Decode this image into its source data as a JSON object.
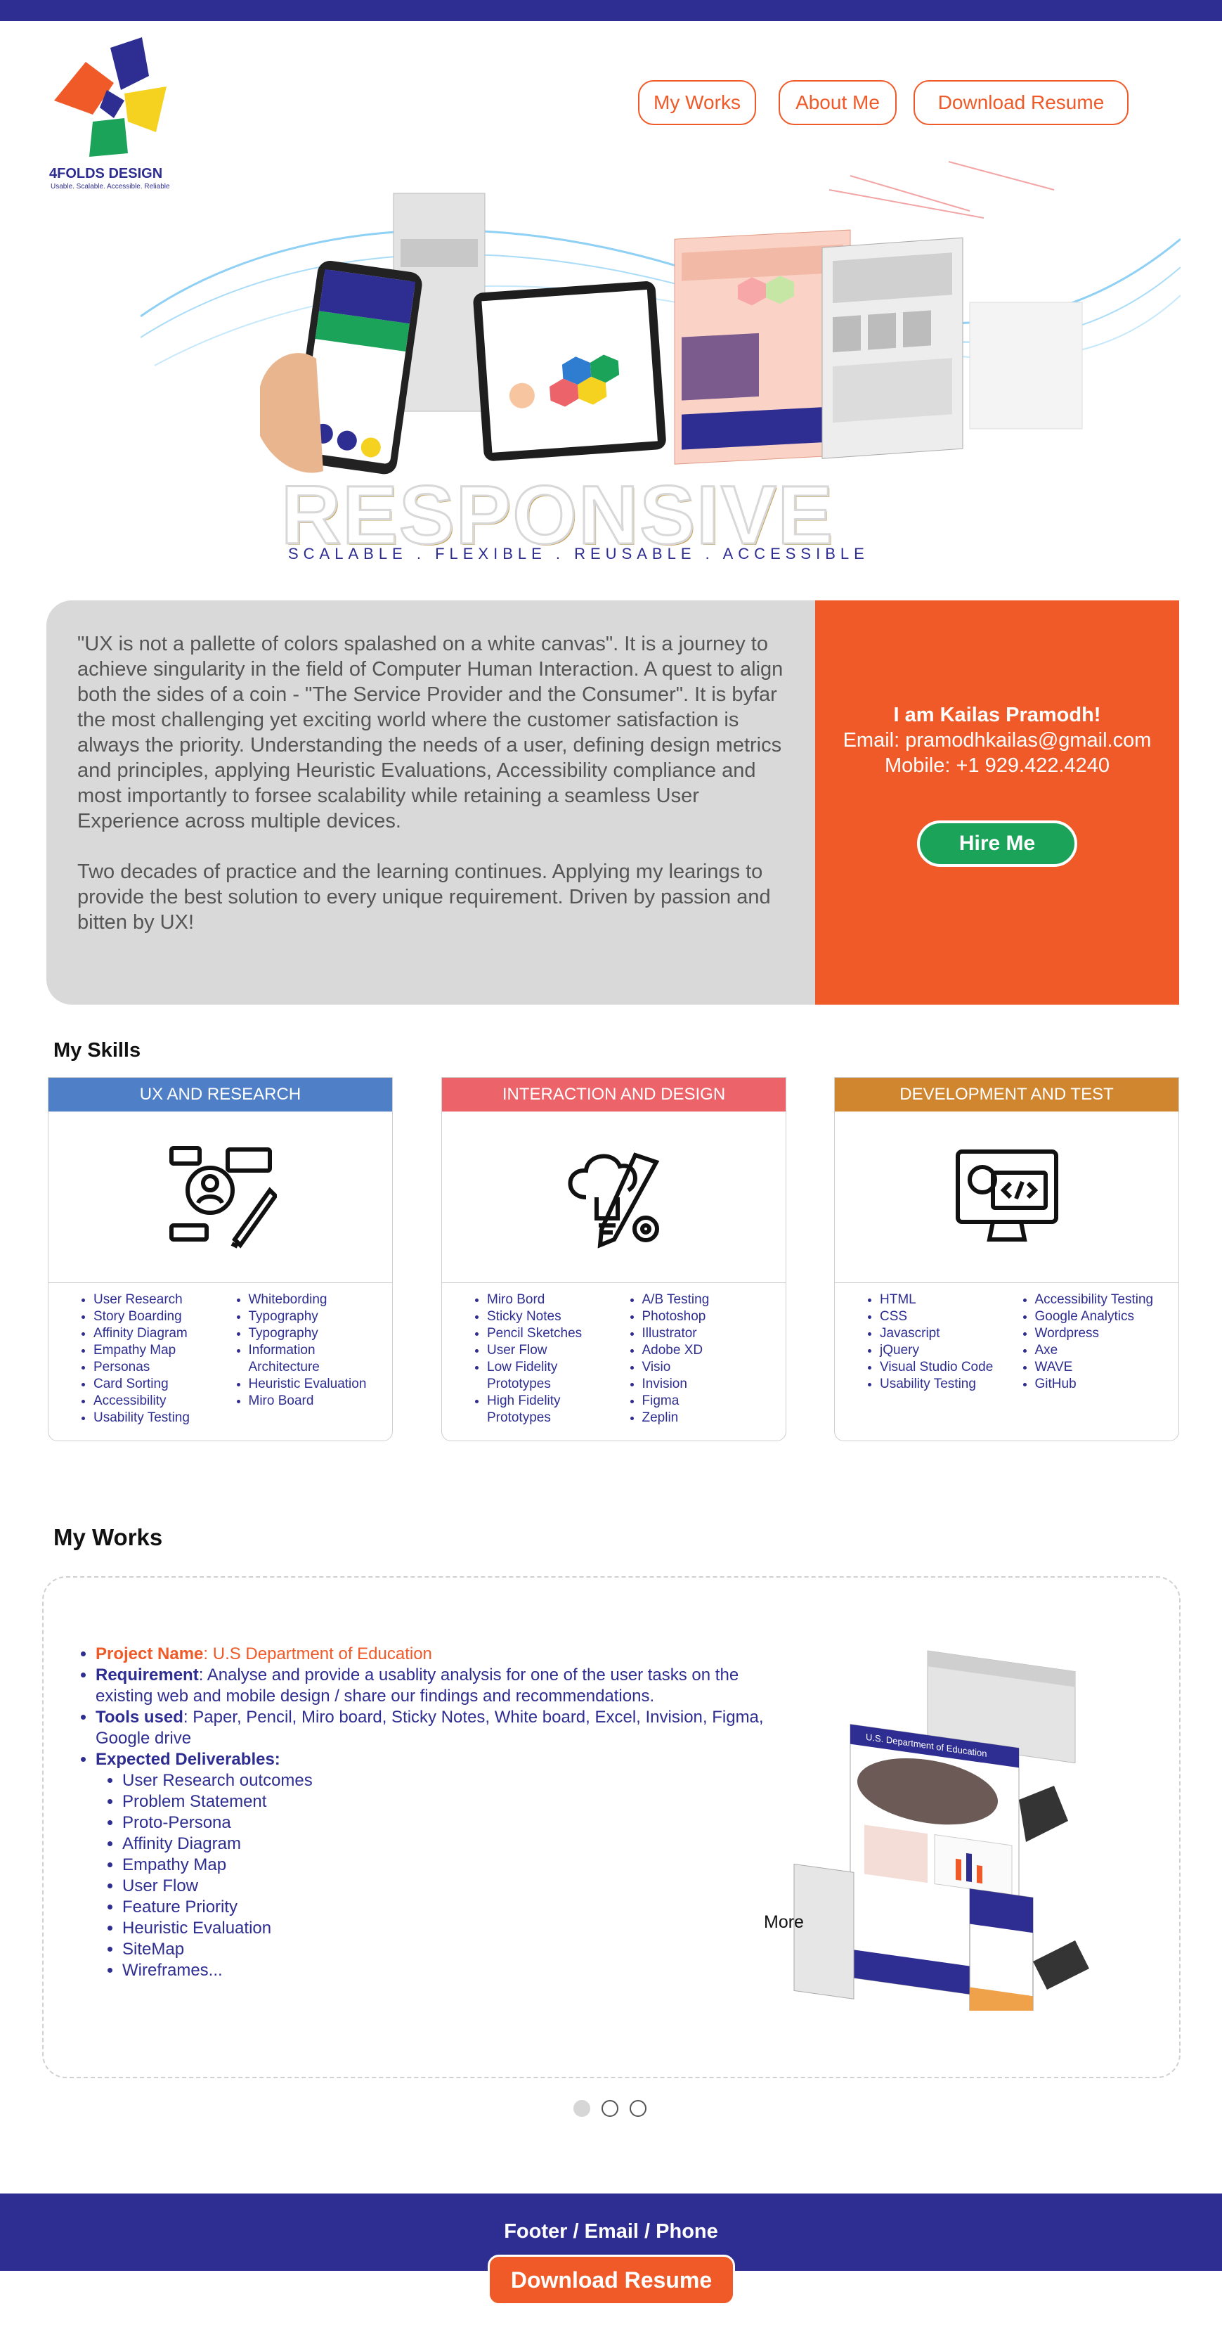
{
  "brand": {
    "name": "4FOLDS DESIGN",
    "tagline": "Usable. Scalable. Accessible. Reliable"
  },
  "nav": {
    "works": "My Works",
    "about": "About Me",
    "resume": "Download Resume"
  },
  "hero": {
    "word": "RESPONSIVE",
    "subtitle": "SCALABLE . FLEXIBLE . REUSABLE . ACCESSIBLE"
  },
  "intro": {
    "p1": "\"UX is not a pallette of colors spalashed on a white canvas\". It is a journey to achieve singularity in the field of Computer Human Interaction. A quest to align both the sides of a coin - \"The Service Provider and the Consumer\". It is byfar the most challenging yet exciting world where the customer satisfaction is always the priority. Understanding the needs of a user, defining design metrics and principles, applying Heuristic Evaluations, Accessibility compliance and most importantly to forsee scalability while retaining a seamless User Experience across multiple devices.",
    "p2": "Two decades of practice and the learning continues. Applying my learings to provide the best solution to every unique requirement. Driven by passion and bitten by UX!"
  },
  "contact": {
    "name": "I am Kailas Pramodh!",
    "email": "Email: pramodhkailas@gmail.com",
    "phone": "Mobile: +1 929.422.4240",
    "hire": "Hire Me"
  },
  "skills": {
    "title": "My Skills",
    "cards": [
      {
        "header": "UX AND RESEARCH",
        "color": "#4f7fc6",
        "left": [
          "User Research",
          "Story Boarding",
          "Affinity Diagram",
          "Empathy Map",
          "Personas",
          "Card Sorting",
          "Accessibility",
          "Usability Testing"
        ],
        "right": [
          "Whitebording",
          "Typography",
          "Typography",
          "Information Architecture",
          "Heuristic Evaluation",
          "Miro Board"
        ]
      },
      {
        "header": "INTERACTION AND DESIGN",
        "color": "#ec6469",
        "left": [
          "Miro Bord",
          "Sticky Notes",
          "Pencil Sketches",
          "User Flow",
          "Low Fidelity Prototypes",
          "High Fidelity Prototypes"
        ],
        "right": [
          "A/B Testing",
          "Photoshop",
          "Illustrator",
          "Adobe XD",
          "Visio",
          "Invision",
          "Figma",
          "Zeplin"
        ]
      },
      {
        "header": "DEVELOPMENT AND TEST",
        "color": "#d0852f",
        "left": [
          "HTML",
          "CSS",
          "Javascript",
          "jQuery",
          "Visual Studio Code",
          "Usability Testing"
        ],
        "right": [
          "Accessibility Testing",
          "Google Analytics",
          "Wordpress",
          "Axe",
          "WAVE",
          "GitHub"
        ]
      }
    ]
  },
  "works": {
    "title": "My Works",
    "project_label": "Project Name",
    "project_value": ": U.S Department of Education",
    "req_label": "Requirement",
    "req_value": ":  Analyse and provide a usablity analysis for one of the user tasks on the existing web and mobile design / share our findings and recommendations.",
    "tools_label": "Tools used",
    "tools_value": ": Paper, Pencil, Miro board, Sticky Notes, White board, Excel, Invision, Figma, Google drive",
    "deliv_label": "Expected Deliverables:",
    "deliverables": [
      "User Research outcomes",
      "Problem Statement",
      "Proto-Persona",
      "Affinity Diagram",
      "Empathy Map",
      "User Flow",
      "Feature Priority",
      "Heuristic Evaluation",
      "SiteMap",
      "Wireframes..."
    ],
    "more": "More",
    "mock_header": "U.S. Department of Education"
  },
  "footer": {
    "text": "Footer /  Email / Phone",
    "resume": "Download Resume"
  },
  "colors": {
    "brand_blue": "#2e2d91",
    "accent_orange": "#f05a28",
    "hire_green": "#1ca35a"
  }
}
